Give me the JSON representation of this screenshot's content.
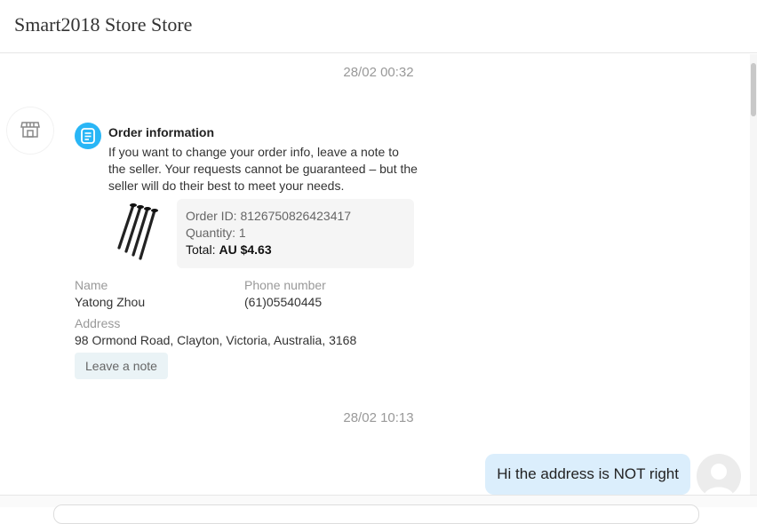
{
  "header": {
    "store_name": "Smart2018 Store Store"
  },
  "messages": {
    "time1": "28/02 00:32",
    "time2": "28/02 10:13"
  },
  "order_card": {
    "title": "Order information",
    "description": "If you want to change your order info, leave a note to the seller. Your requests cannot be guaranteed – but the seller will do their best to meet your needs.",
    "order_id_label": "Order ID:",
    "order_id": "8126750826423417",
    "quantity_label": "Quantity:",
    "quantity": "1",
    "total_label": "Total:",
    "total": "AU $4.63",
    "name_label": "Name",
    "name": "Yatong Zhou",
    "phone_label": "Phone number",
    "phone": "(61)05540445",
    "address_label": "Address",
    "address": "98 Ormond Road, Clayton, Victoria, Australia, 3168",
    "leave_note_label": "Leave a note"
  },
  "user_message": {
    "text": "Hi the address is NOT right"
  },
  "icons": {
    "store_avatar": "store-icon",
    "order": "order-document-icon",
    "user_avatar": "user-icon"
  },
  "colors": {
    "accent": "#29b6f6",
    "bubble": "#dbeefc",
    "leave_note_bg": "#eaf3f6"
  }
}
